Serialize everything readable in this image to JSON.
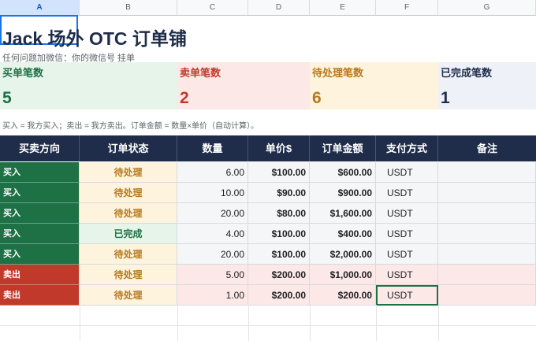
{
  "column_headers": [
    "A",
    "B",
    "C",
    "D",
    "E",
    "F",
    "G"
  ],
  "title": "Jack 场外 OTC 订单铺",
  "subtitle": "任何问题加微信：你的微信号 挂单",
  "stats": [
    {
      "label": "买单笔数",
      "value": "5",
      "color": "#1e7145",
      "bg": "#e6f4ea"
    },
    {
      "label": "卖单笔数",
      "value": "2",
      "color": "#c0392b",
      "bg": "#fce8e6"
    },
    {
      "label": "待处理笔数",
      "value": "6",
      "color": "#b7791f",
      "bg": "#fef3dc"
    },
    {
      "label": "已完成笔数",
      "value": "1",
      "color": "#1f2d4a",
      "bg": "#eef1f7"
    }
  ],
  "note": "买入 = 我方买入；卖出 = 我方卖出。订单金额 = 数量×单价（自动计算）。",
  "table": {
    "headers": [
      "买卖方向",
      "订单状态",
      "数量",
      "单价$",
      "订单金额",
      "支付方式",
      "备注"
    ],
    "rows": [
      {
        "direction": "买入",
        "status": "待处理",
        "qty": "6.00",
        "price": "$100.00",
        "amount": "$600.00",
        "pay": "USDT",
        "note": ""
      },
      {
        "direction": "买入",
        "status": "待处理",
        "qty": "10.00",
        "price": "$90.00",
        "amount": "$900.00",
        "pay": "USDT",
        "note": ""
      },
      {
        "direction": "买入",
        "status": "待处理",
        "qty": "20.00",
        "price": "$80.00",
        "amount": "$1,600.00",
        "pay": "USDT",
        "note": ""
      },
      {
        "direction": "买入",
        "status": "已完成",
        "qty": "4.00",
        "price": "$100.00",
        "amount": "$400.00",
        "pay": "USDT",
        "note": ""
      },
      {
        "direction": "买入",
        "status": "待处理",
        "qty": "20.00",
        "price": "$100.00",
        "amount": "$2,000.00",
        "pay": "USDT",
        "note": ""
      },
      {
        "direction": "卖出",
        "status": "待处理",
        "qty": "5.00",
        "price": "$200.00",
        "amount": "$1,000.00",
        "pay": "USDT",
        "note": ""
      },
      {
        "direction": "卖出",
        "status": "待处理",
        "qty": "1.00",
        "price": "$200.00",
        "amount": "$200.00",
        "pay": "USDT",
        "note": ""
      }
    ]
  },
  "colors": {
    "header_bg": "#1f2d4a",
    "buy": "#1e7145",
    "sell": "#c0392b",
    "pending_text": "#b7791f",
    "pending_bg": "#fef3dc",
    "done_text": "#1e7145",
    "done_bg": "#e6f4ea",
    "buy_row_bg": "#f4f6f8",
    "sell_row_bg": "#fce8e6",
    "selection": "#1a73e8",
    "active_cell": "#1e7145"
  }
}
